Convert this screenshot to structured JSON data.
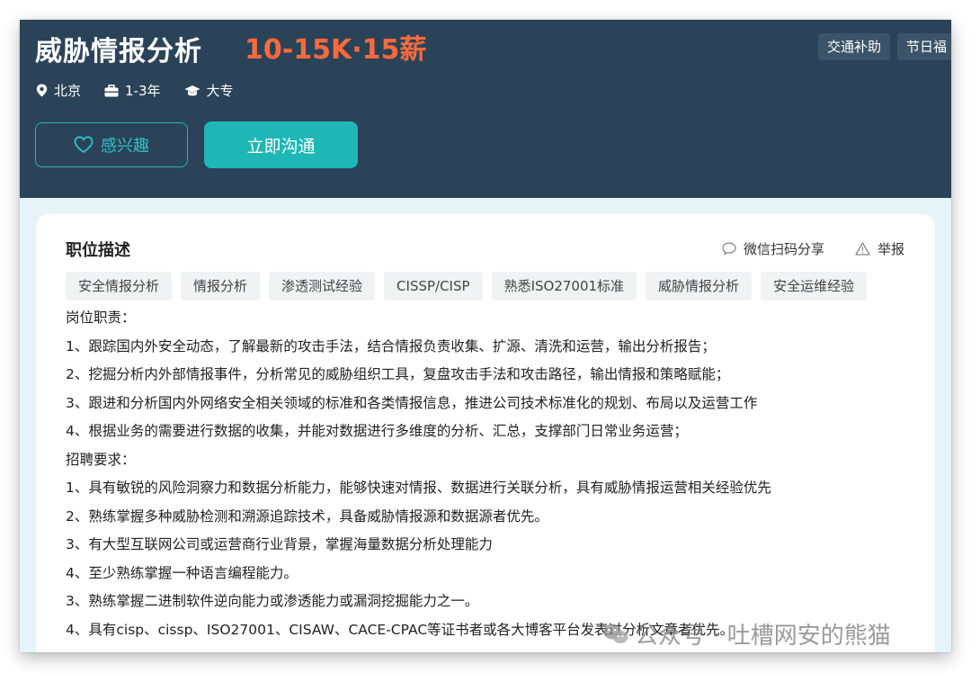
{
  "header": {
    "title": "威胁情报分析",
    "salary": "10-15K·15薪",
    "benefits": [
      "交通补助",
      "节日福"
    ],
    "meta": {
      "location": "北京",
      "experience": "1-3年",
      "education": "大专"
    },
    "interest_label": "感兴趣",
    "chat_label": "立即沟通"
  },
  "card": {
    "title": "职位描述",
    "share_label": "微信扫码分享",
    "report_label": "举报",
    "tags": [
      "安全情报分析",
      "情报分析",
      "渗透测试经验",
      "CISSP/CISP",
      "熟悉ISO27001标准",
      "威胁情报分析",
      "安全运维经验"
    ],
    "lines": [
      "岗位职责：",
      "1、跟踪国内外安全动态，了解最新的攻击手法，结合情报负责收集、扩源、清洗和运营，输出分析报告；",
      "2、挖掘分析内外部情报事件，分析常见的威胁组织工具，复盘攻击手法和攻击路径，输出情报和策略赋能；",
      "3、跟进和分析国内外网络安全相关领域的标准和各类情报信息，推进公司技术标准化的规划、布局以及运营工作",
      "4、根据业务的需要进行数据的收集，并能对数据进行多维度的分析、汇总，支撑部门日常业务运营；",
      "招聘要求：",
      "1、具有敏锐的风险洞察力和数据分析能力，能够快速对情报、数据进行关联分析，具有威胁情报运营相关经验优先",
      "2、熟练掌握多种威胁检测和溯源追踪技术，具备威胁情报源和数据源者优先。",
      "3、有大型互联网公司或运营商行业背景，掌握海量数据分析处理能力",
      "4、至少熟练掌握一种语言编程能力。",
      "3、熟练掌握二进制软件逆向能力或渗透能力或漏洞挖掘能力之一。",
      "4、具有cisp、cissp、ISO27001、CISAW、CACE-CPAC等证书者或各大博客平台发表过分析文章者优先。"
    ]
  },
  "watermark": "公众号 · 吐槽网安的熊猫",
  "colors": {
    "header_bg": "#2b4358",
    "accent": "#1fb7b6",
    "salary": "#ff6a3d",
    "page_bg": "#e6f4f7"
  },
  "icons": [
    "location-pin-icon",
    "briefcase-icon",
    "graduation-cap-icon",
    "heart-icon",
    "chat-bubble-icon",
    "warning-icon",
    "wechat-icon"
  ]
}
